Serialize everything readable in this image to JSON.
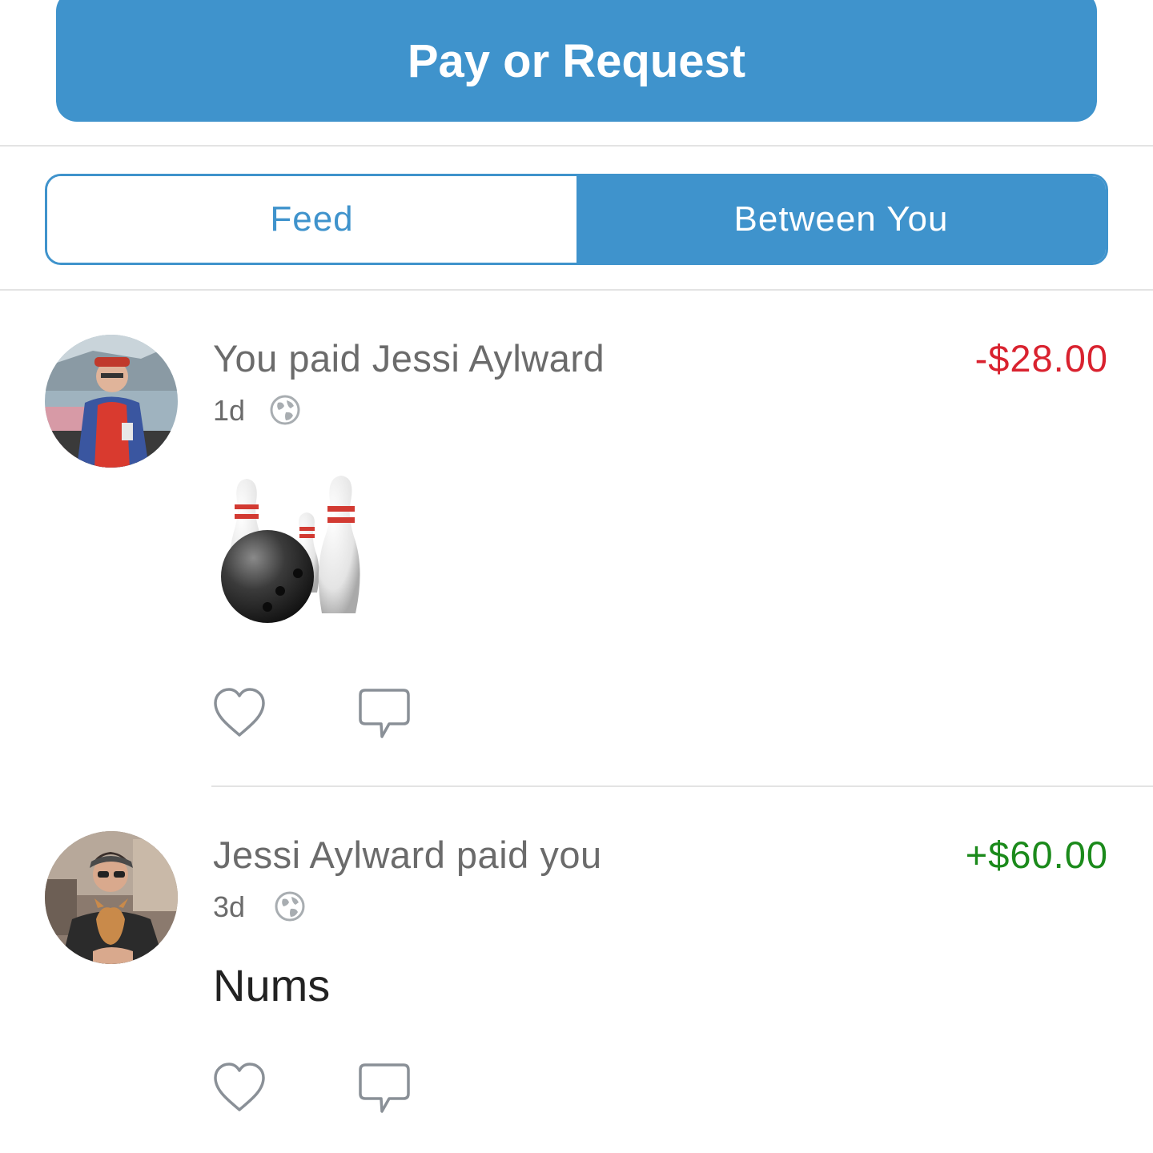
{
  "header": {
    "pay_request_label": "Pay or Request"
  },
  "tabs": [
    {
      "label": "Feed",
      "selected": false
    },
    {
      "label": "Between You",
      "selected": true
    }
  ],
  "colors": {
    "accent": "#3f93cc",
    "negative_amount": "#d9222f",
    "positive_amount": "#1b8a1b"
  },
  "stories": [
    {
      "title": "You paid Jessi Aylward",
      "amount": "-$28.00",
      "time": "1d",
      "audience_icon": "globe-icon",
      "note_emoji": "🎳",
      "note_icon": "bowling-icon"
    },
    {
      "title": "Jessi Aylward paid you",
      "amount": "+$60.00",
      "time": "3d",
      "audience_icon": "globe-icon",
      "note": "Nums"
    }
  ]
}
